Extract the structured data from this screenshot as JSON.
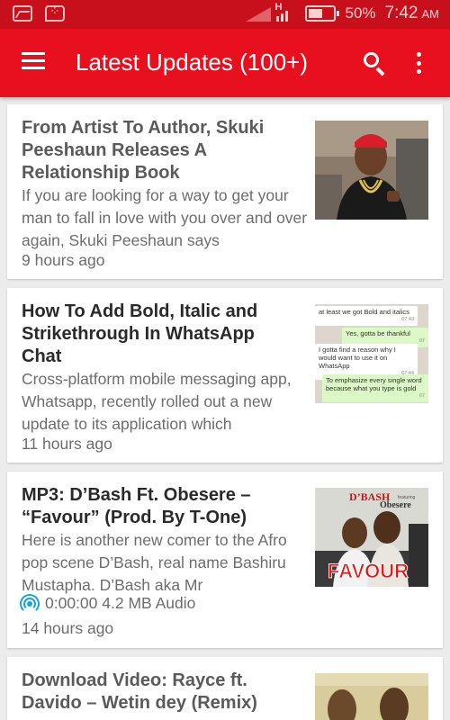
{
  "status_bar": {
    "battery": "50%",
    "time": "7:42",
    "ampm": "AM",
    "network": "H"
  },
  "app_bar": {
    "title": "Latest Updates (100+)"
  },
  "feed": [
    {
      "title": "From Artist To Author, Skuki Peeshaun Releases A Relationship Book",
      "excerpt": "If you are looking for a way to get your man to fall in love with you over and over again, Skuki Peeshaun says",
      "time": "9 hours ago"
    },
    {
      "title": "How To Add Bold, Italic and Strikethrough In WhatsApp Chat",
      "excerpt": "Cross-platform mobile messaging app, Whatsapp, recently rolled out a new update to its application which",
      "time": "11 hours ago",
      "thumb_chat": {
        "msg1": "at least we got Bold and italics",
        "msg1_time": "07:43",
        "msg2": "Yes, gotta be thankful",
        "msg2_time": "07",
        "msg3": "I gotta find a reason why I would want to use it on WhatsApp",
        "msg3_time": "07:44",
        "msg4": "To emphasize every single word because what you type is gold",
        "msg4_time": "07"
      }
    },
    {
      "title": "MP3: D’Bash Ft. Obesere – “Favour” (Prod. By T-One)",
      "excerpt": "Here is another new comer to the Afro pop scene D’Bash, real name Bashiru Mustapha. D’Bash aka Mr",
      "audio": "0:00:00 4.2 MB Audio",
      "time": "14 hours ago",
      "thumb_text": {
        "artist": "D’BASH",
        "featuring": "featuring",
        "feat": "Obesere",
        "song": "FAVOUR"
      }
    },
    {
      "title": "Download Video: Rayce ft. Davido – Wetin dey (Remix)"
    }
  ],
  "colors": {
    "status_bar": "#c8101c",
    "app_bar": "#e8101e",
    "audio_icon": "#1aa3d8"
  }
}
